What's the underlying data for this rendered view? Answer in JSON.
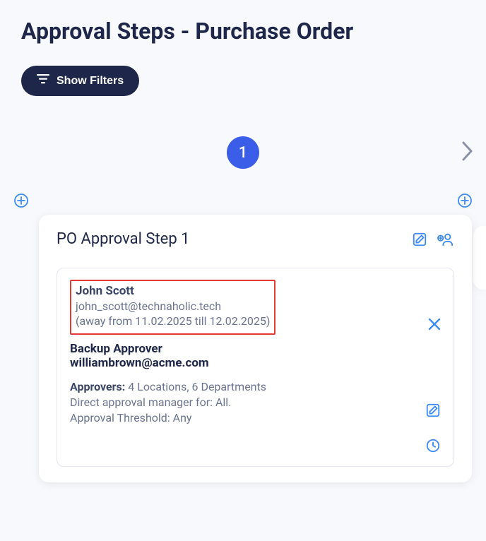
{
  "pageTitle": "Approval Steps - Purchase Order",
  "filterButton": "Show Filters",
  "stepNumber": "1",
  "card": {
    "title": "PO Approval Step 1",
    "approver": {
      "name": "John Scott",
      "email": "john_scott@technaholic.tech",
      "away": "(away from 11.02.2025 till 12.02.2025)"
    },
    "backup": {
      "title": "Backup Approver",
      "email": "williambrown@acme.com"
    },
    "meta": {
      "approversLabel": "Approvers:",
      "approversValue": " 4 Locations, 6 Departments",
      "directManager": "Direct approval manager for: All.",
      "threshold": "Approval Threshold: Any"
    }
  }
}
